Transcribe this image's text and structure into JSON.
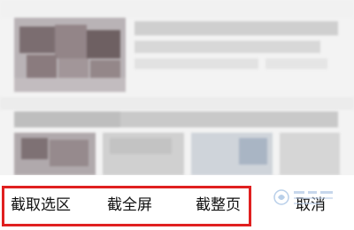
{
  "toolbar": {
    "capture_area_label": "截取选区",
    "capture_fullscreen_label": "截全屏",
    "capture_page_label": "截整页",
    "cancel_label": "取消"
  },
  "colors": {
    "highlight": "#e02020",
    "toolbar_bg": "#ffffff",
    "text": "#111111"
  },
  "icons": {
    "watermark": "baidu-jingyan-watermark-icon"
  }
}
